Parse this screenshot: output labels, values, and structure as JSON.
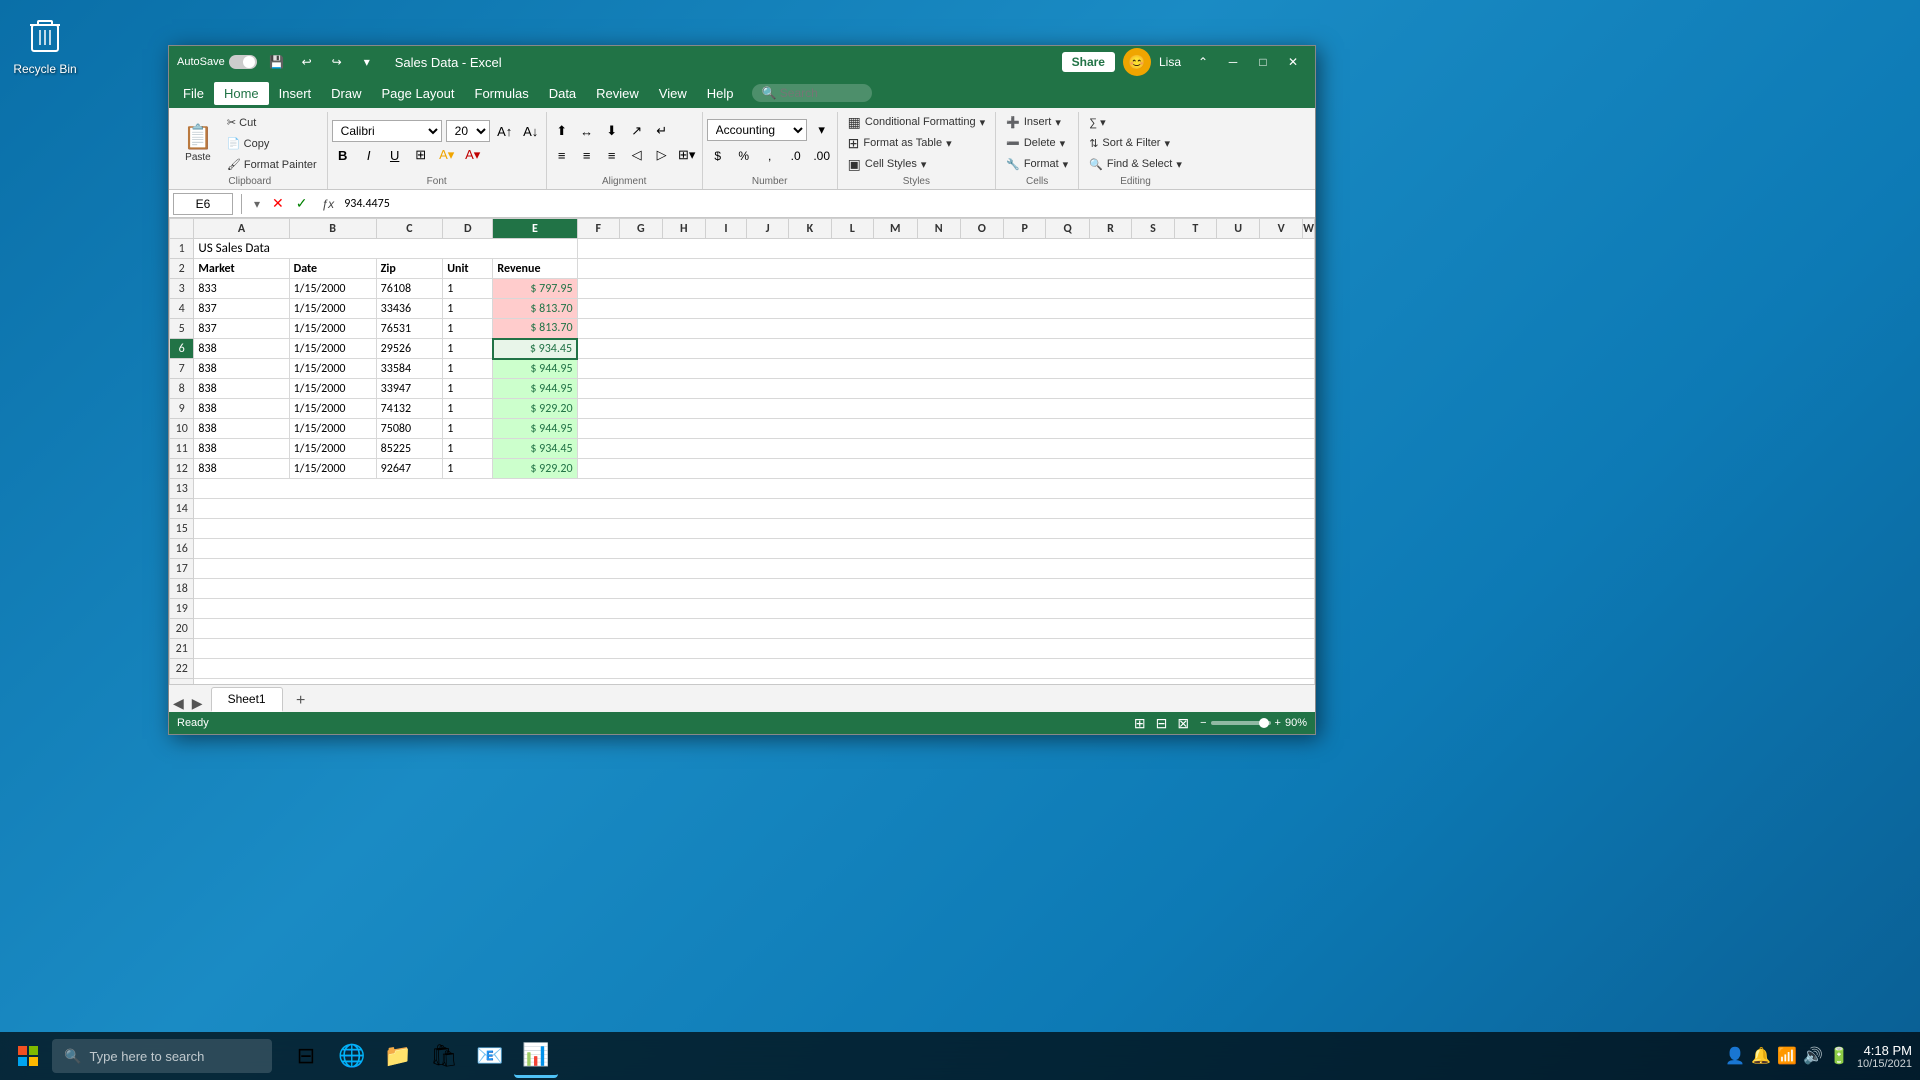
{
  "desktop": {
    "recycle_bin_label": "Recycle Bin"
  },
  "window": {
    "title": "Sales Data - Excel",
    "autosave_label": "AutoSave",
    "user_name": "Lisa",
    "share_label": "Share"
  },
  "menu": {
    "items": [
      "File",
      "Home",
      "Insert",
      "Draw",
      "Page Layout",
      "Formulas",
      "Data",
      "Review",
      "View",
      "Help"
    ]
  },
  "ribbon": {
    "clipboard_label": "Clipboard",
    "font_label": "Font",
    "alignment_label": "Alignment",
    "number_label": "Number",
    "styles_label": "Styles",
    "cells_label": "Cells",
    "editing_label": "Editing",
    "font_name": "Calibri",
    "font_size": "20",
    "number_format": "Accounting",
    "paste_label": "Paste",
    "bold_label": "B",
    "italic_label": "I",
    "underline_label": "U",
    "conditional_formatting_label": "Conditional Formatting",
    "format_as_table_label": "Format as Table",
    "cell_styles_label": "Cell Styles",
    "insert_label": "Insert",
    "delete_label": "Delete",
    "format_label": "Format",
    "sort_filter_label": "Sort & Filter",
    "find_select_label": "Find & Select"
  },
  "formula_bar": {
    "cell_ref": "E6",
    "formula": "934.4475"
  },
  "spreadsheet": {
    "title_row": {
      "col": "A",
      "row": 1,
      "value": "US Sales Data"
    },
    "headers": [
      "Market",
      "Date",
      "Zip",
      "Unit",
      "Revenue"
    ],
    "columns": [
      "A",
      "B",
      "C",
      "D",
      "E",
      "F",
      "G",
      "H",
      "I",
      "J",
      "K",
      "L",
      "M",
      "N",
      "O",
      "P",
      "Q",
      "R",
      "S",
      "T",
      "U",
      "V",
      "W"
    ],
    "rows": [
      {
        "row": 3,
        "market": "833",
        "date": "1/15/2000",
        "zip": "76108",
        "unit": "1",
        "revenue": "$ 797.95",
        "highlight": "red"
      },
      {
        "row": 4,
        "market": "837",
        "date": "1/15/2000",
        "zip": "33436",
        "unit": "1",
        "revenue": "$ 813.70",
        "highlight": "red"
      },
      {
        "row": 5,
        "market": "837",
        "date": "1/15/2000",
        "zip": "76531",
        "unit": "1",
        "revenue": "$ 813.70",
        "highlight": "red"
      },
      {
        "row": 6,
        "market": "838",
        "date": "1/15/2000",
        "zip": "29526",
        "unit": "1",
        "revenue": "$ 934.45",
        "highlight": "selected"
      },
      {
        "row": 7,
        "market": "838",
        "date": "1/15/2000",
        "zip": "33584",
        "unit": "1",
        "revenue": "$ 944.95",
        "highlight": "green"
      },
      {
        "row": 8,
        "market": "838",
        "date": "1/15/2000",
        "zip": "33947",
        "unit": "1",
        "revenue": "$ 944.95",
        "highlight": "green"
      },
      {
        "row": 9,
        "market": "838",
        "date": "1/15/2000",
        "zip": "74132",
        "unit": "1",
        "revenue": "$ 929.20",
        "highlight": "green"
      },
      {
        "row": 10,
        "market": "838",
        "date": "1/15/2000",
        "zip": "75080",
        "unit": "1",
        "revenue": "$ 944.95",
        "highlight": "green"
      },
      {
        "row": 11,
        "market": "838",
        "date": "1/15/2000",
        "zip": "85225",
        "unit": "1",
        "revenue": "$ 934.45",
        "highlight": "green"
      },
      {
        "row": 12,
        "market": "838",
        "date": "1/15/2000",
        "zip": "92647",
        "unit": "1",
        "revenue": "$ 929.20",
        "highlight": "green"
      }
    ]
  },
  "sheet_tabs": {
    "sheets": [
      "Sheet1"
    ],
    "active": "Sheet1",
    "add_label": "+"
  },
  "status_bar": {
    "status": "Ready",
    "zoom": "90%"
  },
  "taskbar": {
    "search_placeholder": "Type here to search",
    "time": "4:18 PM",
    "date": "10/15/2021"
  }
}
